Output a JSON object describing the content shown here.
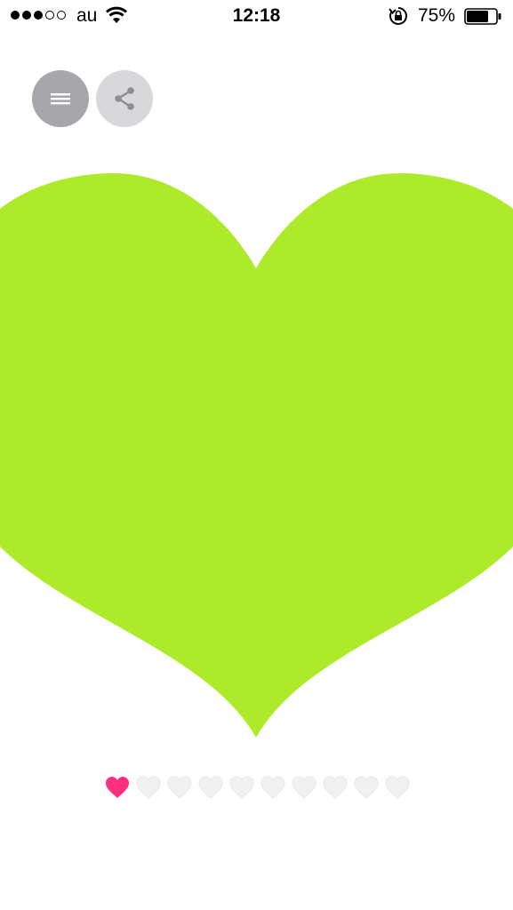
{
  "status_bar": {
    "signal_bars_filled": 3,
    "signal_bars_total": 5,
    "carrier": "au",
    "time": "12:18",
    "battery_percent_label": "75%",
    "battery_level": 0.75
  },
  "toolbar": {
    "menu_icon": "hamburger-icon",
    "share_icon": "share-icon"
  },
  "main": {
    "heart_color": "#acea2a"
  },
  "pager": {
    "page_count": 10,
    "current_page": 1,
    "active_color": "#ff2f7f",
    "inactive_color": "#f1f1f1"
  }
}
